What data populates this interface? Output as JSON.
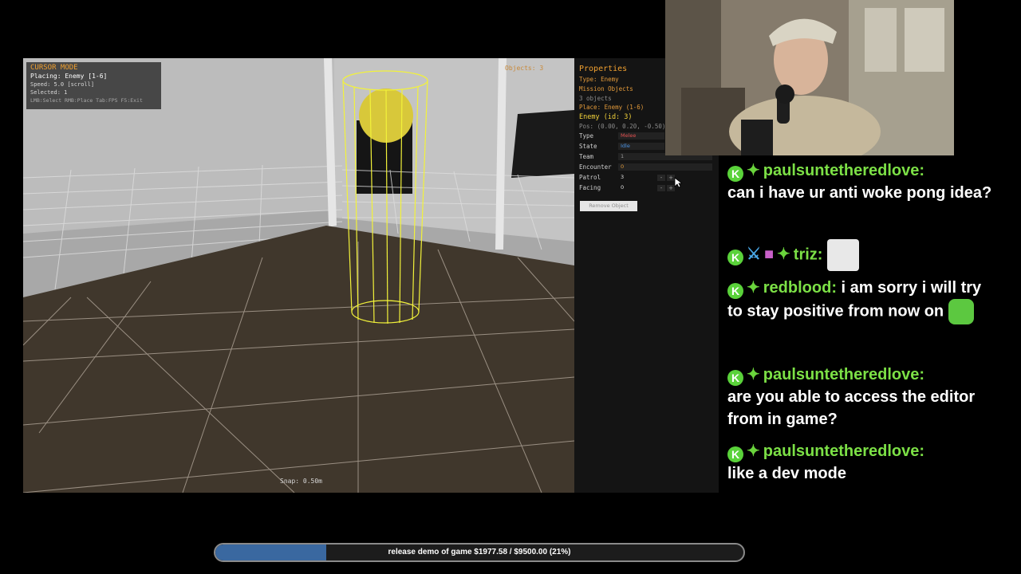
{
  "editor": {
    "cursor_panel": {
      "title": "CURSOR MODE",
      "placing": "Placing: Enemy [1-6]",
      "speed": "Speed: 5.0 [scroll]",
      "selected": "Selected: 1",
      "controls": "LMB:Select  RMB:Place  Tab:FPS  F5:Exit"
    },
    "objects_count": "Objects: 3",
    "snap": "Snap: 0.50m"
  },
  "properties": {
    "title": "Properties",
    "type_line": "Type: Enemy",
    "mission_objects": "Mission Objects",
    "objects_sub": "3 objects",
    "place_hint": "Place: Enemy (1-6)",
    "enemy_header": "Enemy (id: 3)",
    "pos": "Pos: (0.00, 0.20, -0.50)",
    "fields": [
      {
        "label": "Type",
        "value": "Melee",
        "color": "#e05050"
      },
      {
        "label": "State",
        "value": "Idle",
        "color": "#4a90e0"
      },
      {
        "label": "Team",
        "value": "1",
        "color": "#9a9a9a"
      },
      {
        "label": "Encounter",
        "value": "0",
        "color": "#e09a3a"
      },
      {
        "label": "Patrol",
        "value": "3",
        "color": "#e0e0e0"
      },
      {
        "label": "Facing",
        "value": "0",
        "color": "#e0e0e0"
      }
    ],
    "stepper_minus": "-",
    "stepper_plus": "+",
    "remove_button": "Remove Object"
  },
  "chat": {
    "messages": [
      {
        "user": "paulsuntetheredlove:",
        "text": "can i have ur anti woke pong idea?"
      },
      {
        "user": "triz:",
        "text": ""
      },
      {
        "user": "redblood:",
        "text": "i am sorry i will try to stay positive from now on"
      },
      {
        "user": "paulsuntetheredlove:",
        "text": "are you able to access the editor from in game?"
      },
      {
        "user": "paulsuntetheredlove:",
        "text": "like a dev mode"
      }
    ]
  },
  "progress": {
    "label": "release demo of game $1977.58 / $9500.00 (21%)",
    "fraction": 0.21
  },
  "icons": {
    "badge": "kick-badge-icon",
    "plus": "verified-plus-icon",
    "sword": "sword-icon",
    "gift": "gift-icon"
  },
  "colors": {
    "accent_orange": "#f0a030",
    "username_green": "#7ce046",
    "progress_blue": "#3a68a0",
    "selection_yellow": "#f2f23a"
  }
}
